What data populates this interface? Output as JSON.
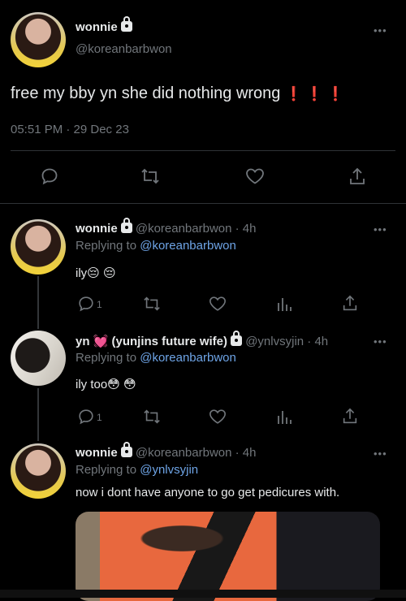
{
  "main_tweet": {
    "name": "wonnie",
    "handle": "@koreanbarbwon",
    "text": "free my bby yn she did nothing wrong",
    "exclamations": "❗ ❗ ❗",
    "timestamp": "05:51 PM · 29 Dec 23"
  },
  "replies": [
    {
      "name": "wonnie",
      "handle_time": "@koreanbarbwon · 4h",
      "replying_label": "Replying to",
      "replying_to": "@koreanbarbwon",
      "text": "ily😔 😔",
      "reply_count": "1"
    },
    {
      "name": "yn 💓 (yunjins future wife)",
      "handle_time": "@ynlvsyjin · 4h",
      "replying_label": "Replying to",
      "replying_to": "@koreanbarbwon",
      "text": "ily too😳 😳",
      "reply_count": "1"
    },
    {
      "name": "wonnie",
      "handle_time": "@koreanbarbwon · 4h",
      "replying_label": "Replying to",
      "replying_to": "@ynlvsyjin",
      "text": "now i dont have anyone to go get pedicures with."
    }
  ],
  "more_label": "•••",
  "colors": {
    "background": "#000000",
    "text": "#e7e9ea",
    "muted": "#71767b",
    "link": "#6ea4e6",
    "accent_red": "#f4212e"
  }
}
